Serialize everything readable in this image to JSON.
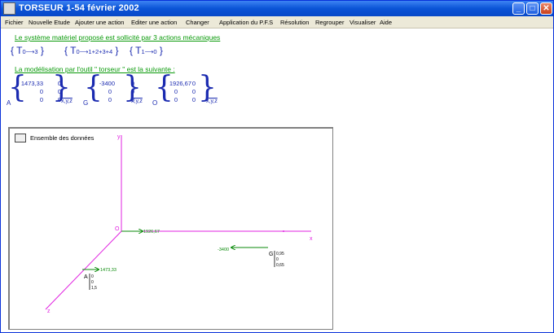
{
  "window": {
    "title": "TORSEUR 1-54  février 2002"
  },
  "menu": [
    "Fichier",
    "Nouvelle Etude",
    "Ajouter une action",
    "Editer une action",
    "Changer",
    "Application du P.F.S",
    "Résolution",
    "Regrouper",
    "Visualiser",
    "Aide"
  ],
  "system": {
    "line": "Le système matériel proposé est sollicité par 3 actions mécaniques",
    "torsors": [
      {
        "T": "T",
        "sub": "0⟶3"
      },
      {
        "T": "T",
        "sub": "0⟶1+2+3+4"
      },
      {
        "T": "T",
        "sub": "1⟶0"
      }
    ]
  },
  "model": {
    "line": "La modélisation par l'outil \" torseur \" est la suivante :",
    "matrices": [
      {
        "point": "A",
        "rows": [
          [
            "1473,33",
            "0"
          ],
          [
            "0",
            "0"
          ],
          [
            "0",
            "0"
          ]
        ],
        "basis": "x,y,z"
      },
      {
        "point": "G",
        "rows": [
          [
            "-3400",
            "0"
          ],
          [
            "0",
            "0"
          ],
          [
            "0",
            "0"
          ]
        ],
        "basis": "x,y,z"
      },
      {
        "point": "O",
        "rows": [
          [
            "1926,67",
            "0"
          ],
          [
            "0",
            "0"
          ],
          [
            "0",
            "0"
          ]
        ],
        "basis": "x,y,z"
      }
    ]
  },
  "view": {
    "label": "Ensemble des données",
    "axis_x": "x",
    "axis_y": "y",
    "axis_z": "z",
    "origin": "O",
    "force_O": "1926,67",
    "force_G": "-3400",
    "force_A": "1473,33",
    "point_G": {
      "name": "G",
      "coords": [
        "0,95",
        "0",
        "0,65"
      ]
    },
    "point_A": {
      "name": "A",
      "coords": [
        "0",
        "0",
        "1,5"
      ]
    }
  },
  "colors": {
    "axis": "#e020e0",
    "force": "#0a8a0a",
    "text": "#1a2ab0",
    "title_bg": "#0a53d6"
  }
}
